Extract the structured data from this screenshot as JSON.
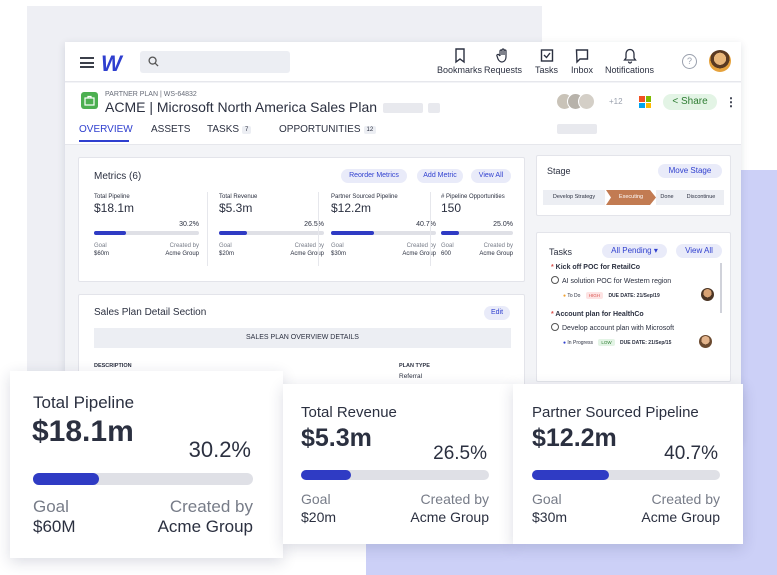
{
  "nav": {
    "bookmarks": "Bookmarks",
    "requests": "Requests",
    "tasks": "Tasks",
    "inbox": "Inbox",
    "notifications": "Notifications",
    "help": "?"
  },
  "plan": {
    "subtitle": "PARTNER PLAN | WS-64832",
    "title": "ACME | Microsoft North America Sales Plan",
    "extra_members": "+12",
    "share": "Share"
  },
  "tabs": [
    {
      "label": "OVERVIEW"
    },
    {
      "label": "ASSETS"
    },
    {
      "label": "TASKS",
      "count": "7"
    },
    {
      "label": "OPPORTUNITIES",
      "count": "12"
    }
  ],
  "metrics": {
    "title": "Metrics (6)",
    "reorder": "Reorder Metrics",
    "add": "Add Metric",
    "view_all": "View All",
    "goal_label": "Goal",
    "created_label": "Created by",
    "items": [
      {
        "label": "Total Pipeline",
        "value": "$18.1m",
        "pct": "30.2%",
        "progress": 0.302,
        "goal": "$60m",
        "created_by": "Acme Group"
      },
      {
        "label": "Total Revenue",
        "value": "$5.3m",
        "pct": "26.5%",
        "progress": 0.265,
        "goal": "$20m",
        "created_by": "Acme Group"
      },
      {
        "label": "Partner Sourced Pipeline",
        "value": "$12.2m",
        "pct": "40.7%",
        "progress": 0.407,
        "goal": "$30m",
        "created_by": "Acme Group"
      },
      {
        "label": "# Pipeline Opportunities",
        "value": "150",
        "pct": "25.0%",
        "progress": 0.25,
        "goal": "600",
        "created_by": "Acme Group"
      }
    ]
  },
  "stage": {
    "title": "Stage",
    "move": "Move Stage",
    "steps": [
      "Develop Strategy",
      "Executing",
      "Done",
      "Discontinue"
    ],
    "current": "Executing"
  },
  "tasks": {
    "title": "Tasks",
    "filter": "All Pending",
    "view_all": "View All",
    "items": [
      {
        "group": "Kick off POC for RetailCo",
        "name": "AI solution POC for Western region",
        "status": "To Do",
        "priority": "HIGH",
        "due": "DUE DATE: 21/Sep/19"
      },
      {
        "group": "Account plan for HealthCo",
        "name": "Develop account plan with Microsoft",
        "status": "In Progress",
        "priority": "LOW",
        "due": "DUE DATE: 21/Sep/15"
      }
    ]
  },
  "detail": {
    "title": "Sales Plan Detail Section",
    "edit": "Edit",
    "overview_header": "SALES PLAN OVERVIEW DETAILS",
    "description_label": "DESCRIPTION",
    "plan_type_label": "PLAN TYPE",
    "plan_type_value": "Referral"
  },
  "big_cards": {
    "goal_label": "Goal",
    "created_label": "Created by",
    "items": [
      {
        "label": "Total Pipeline",
        "value": "$18.1m",
        "pct": "30.2%",
        "progress": 0.302,
        "goal": "$60M",
        "created_by": "Acme Group"
      },
      {
        "label": "Total Revenue",
        "value": "$5.3m",
        "pct": "26.5%",
        "progress": 0.265,
        "goal": "$20m",
        "created_by": "Acme Group"
      },
      {
        "label": "Partner Sourced Pipeline",
        "value": "$12.2m",
        "pct": "40.7%",
        "progress": 0.407,
        "goal": "$30m",
        "created_by": "Acme Group"
      }
    ]
  },
  "colors": {
    "accent": "#2f3fcf",
    "bar_fill": "#2f3bc4",
    "bar_track": "#dfe0e6",
    "stage_active": "#c27b52",
    "share_green": "#2e7d32"
  }
}
